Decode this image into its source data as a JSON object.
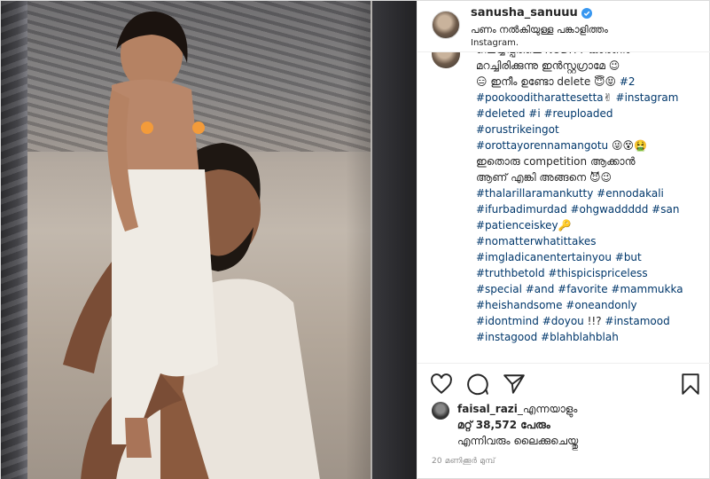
{
  "header": {
    "username": "sanusha_sanuuu",
    "subtitle": "പണം നൽകിയുള്ള പങ്കാളിത്തം",
    "subtitle2": "Instagram."
  },
  "caption_lines": [
    [
      {
        "t": "ഷെയ്യപ്പരിലെ NUDITY കാരണം",
        "tag": false
      }
    ],
    [
      {
        "t": "മറച്ചിരിക്കുന്നു ഇൻസ്റ്റഗ്രാമേ 😉",
        "tag": false
      }
    ],
    [
      {
        "t": "😑 ഇനീം ഉണ്ടോ delete 😇😝 ",
        "tag": false
      },
      {
        "t": "#2",
        "tag": true
      }
    ],
    [
      {
        "t": "#pookooditharattesetta",
        "tag": true
      },
      {
        "t": "✌ ",
        "tag": false
      },
      {
        "t": "#instagram",
        "tag": true
      }
    ],
    [
      {
        "t": "#deleted #i #reuploaded",
        "tag": true
      }
    ],
    [
      {
        "t": "#orustrikeingot",
        "tag": true
      }
    ],
    [
      {
        "t": "#orottayorennamangotu",
        "tag": true
      },
      {
        "t": " 😜😵🤮",
        "tag": false
      }
    ],
    [
      {
        "t": "ഇതൊരു competition ആക്കാൻ",
        "tag": false
      }
    ],
    [
      {
        "t": "ആണ് എങ്കി അങ്ങനെ 😈😉",
        "tag": false
      }
    ],
    [
      {
        "t": "#thalarillaramankutty #ennodakali",
        "tag": true
      }
    ],
    [
      {
        "t": "#ifurbadimurdad #ohgwaddddd #san",
        "tag": true
      }
    ],
    [
      {
        "t": "#patienceiskey",
        "tag": true
      },
      {
        "t": "🔑",
        "tag": false
      }
    ],
    [
      {
        "t": "#nomatterwhatittakes",
        "tag": true
      }
    ],
    [
      {
        "t": "#imgladicanentertainyou #but",
        "tag": true
      }
    ],
    [
      {
        "t": "#truthbetold #thispicispriceless",
        "tag": true
      }
    ],
    [
      {
        "t": "#special #and #favorite #mammukka",
        "tag": true
      }
    ],
    [
      {
        "t": "#heishandsome #oneandonly",
        "tag": true
      }
    ],
    [
      {
        "t": "#idontmind #doyou",
        "tag": true
      },
      {
        "t": " !!? ",
        "tag": false
      },
      {
        "t": "#instamood",
        "tag": true
      }
    ],
    [
      {
        "t": "#instagood #blahblahblah",
        "tag": true
      }
    ]
  ],
  "actions": {
    "like": "heart-icon",
    "comment": "comment-icon",
    "share": "share-icon",
    "save": "bookmark-icon"
  },
  "likes": {
    "liker": "faisal_razi",
    "liker_suffix": "_എന്നയാളും",
    "count_line": "മറ്റ് 38,572 പേരും",
    "tail": "എന്നിവരും ലൈക്കുചെയ്തു"
  },
  "timestamp": "20 മണിക്കൂർ മുമ്പ്",
  "colors": {
    "hashtag": "#00376b",
    "verified": "#3897f0",
    "timestamp": "#8e8e8e"
  }
}
